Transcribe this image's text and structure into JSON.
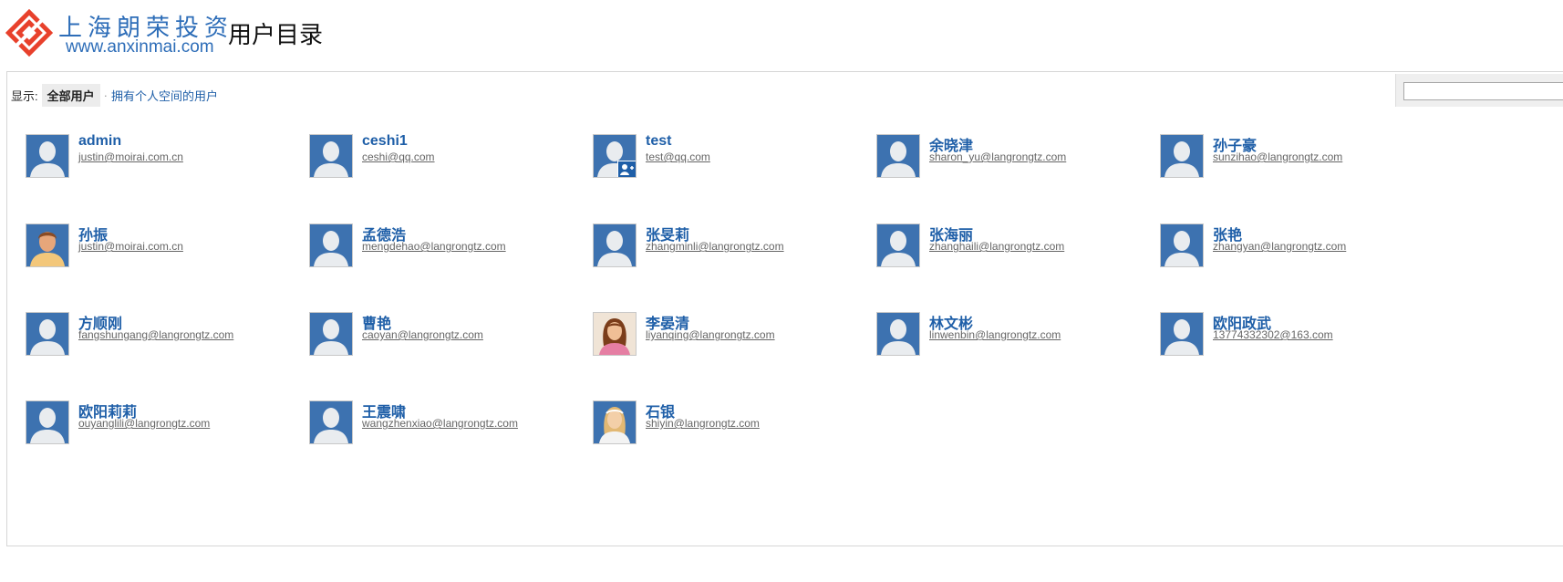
{
  "header": {
    "logo_cn": "上海朗荣投资",
    "logo_url": "www.anxinmai.com",
    "title": "用户目录"
  },
  "filter": {
    "label": "显示:",
    "all_users": "全部用户",
    "separator": "·",
    "with_space": "拥有个人空间的用户"
  },
  "search": {
    "value": ""
  },
  "colors": {
    "accent": "#1f5fa8",
    "logo_red": "#e8412c",
    "avatar_blue": "#3d72b0"
  },
  "users": [
    {
      "name": "admin",
      "email": "justin@moirai.com.cn",
      "avatar": "default"
    },
    {
      "name": "ceshi1",
      "email": "ceshi@qq.com",
      "avatar": "default"
    },
    {
      "name": "test",
      "email": "test@qq.com",
      "avatar": "default-badge"
    },
    {
      "name": "余晓津",
      "email": "sharon_yu@langrongtz.com",
      "avatar": "default"
    },
    {
      "name": "孙子豪",
      "email": "sunzihao@langrongtz.com",
      "avatar": "default"
    },
    {
      "name": "孙振",
      "email": "justin@moirai.com.cn",
      "avatar": "male-photo"
    },
    {
      "name": "孟德浩",
      "email": "mengdehao@langrongtz.com",
      "avatar": "default"
    },
    {
      "name": "张旻莉",
      "email": "zhangminli@langrongtz.com",
      "avatar": "default"
    },
    {
      "name": "张海丽",
      "email": "zhanghaili@langrongtz.com",
      "avatar": "default"
    },
    {
      "name": "张艳",
      "email": "zhangyan@langrongtz.com",
      "avatar": "default"
    },
    {
      "name": "方顺刚",
      "email": "fangshungang@langrongtz.com",
      "avatar": "default"
    },
    {
      "name": "曹艳",
      "email": "caoyan@langrongtz.com",
      "avatar": "default"
    },
    {
      "name": "李晏清",
      "email": "liyanqing@langrongtz.com",
      "avatar": "female-photo"
    },
    {
      "name": "林文彬",
      "email": "linwenbin@langrongtz.com",
      "avatar": "default"
    },
    {
      "name": "欧阳政武",
      "email": "13774332302@163.com",
      "avatar": "default"
    },
    {
      "name": "欧阳莉莉",
      "email": "ouyanglili@langrongtz.com",
      "avatar": "default"
    },
    {
      "name": "王震啸",
      "email": "wangzhenxiao@langrongtz.com",
      "avatar": "default"
    },
    {
      "name": "石银",
      "email": "shiyin@langrongtz.com",
      "avatar": "female-photo-2"
    }
  ]
}
